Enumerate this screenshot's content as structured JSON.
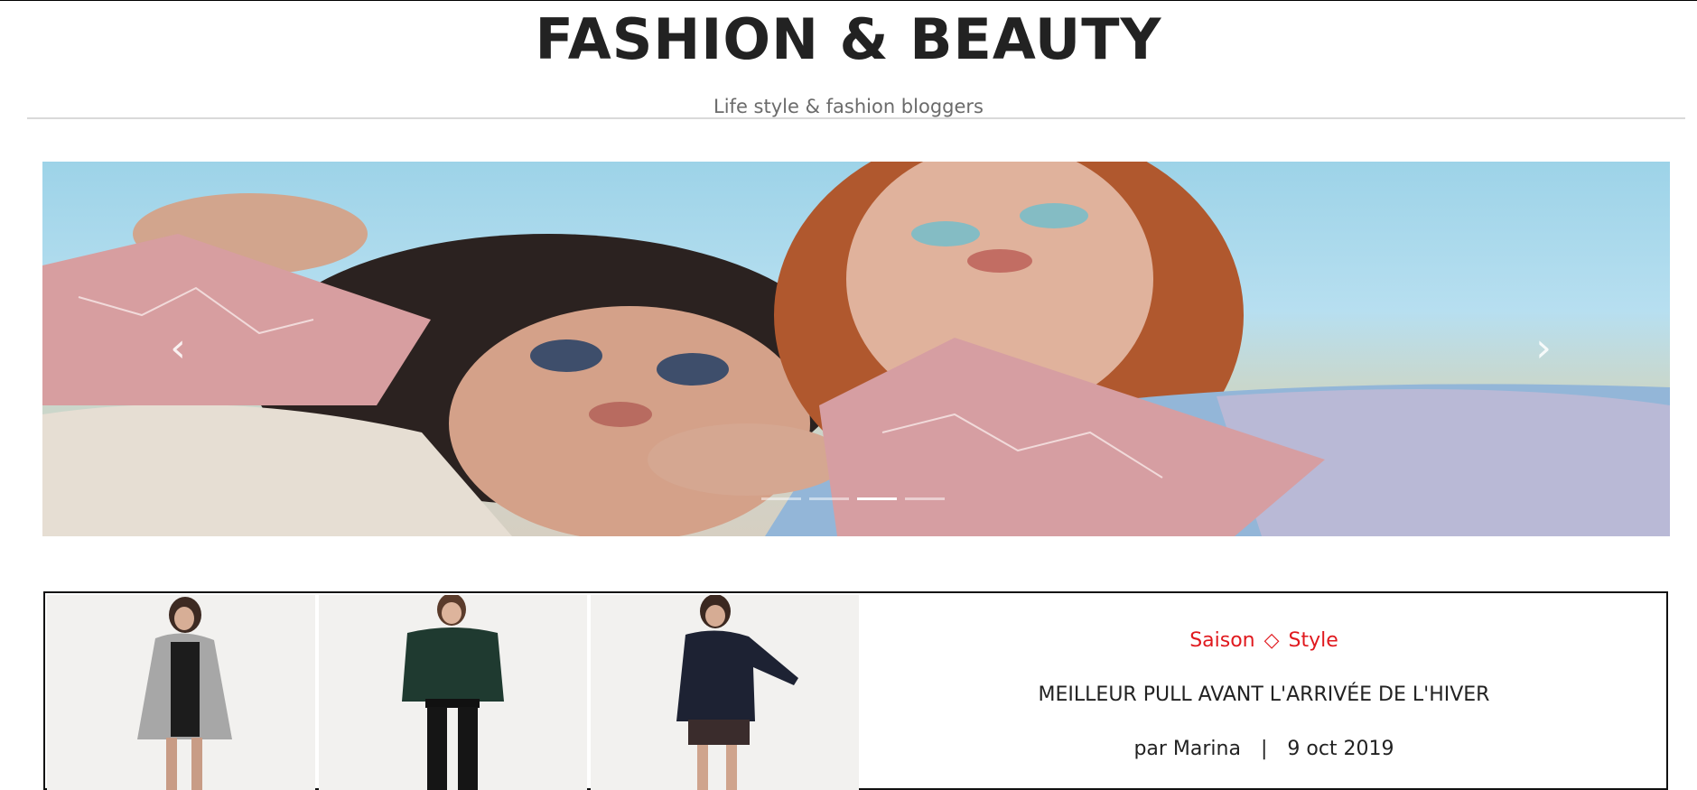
{
  "header": {
    "title": "FASHION & BEAUTY",
    "tagline": "Life style & fashion bloggers"
  },
  "carousel": {
    "prev_icon": "chevron-left-icon",
    "next_icon": "chevron-right-icon",
    "slide_count": 4,
    "active_slide": 3
  },
  "post": {
    "categories": [
      "Saison",
      "Style"
    ],
    "category_separator": "◇",
    "title": "MEILLEUR PULL AVANT L'ARRIVÉE DE L'HIVER",
    "author_prefix": "par Marina",
    "separator": "|",
    "date": "9 oct 2019"
  },
  "colors": {
    "accent": "#e0191e",
    "text": "#222222",
    "tagline": "#6b6b6b"
  }
}
